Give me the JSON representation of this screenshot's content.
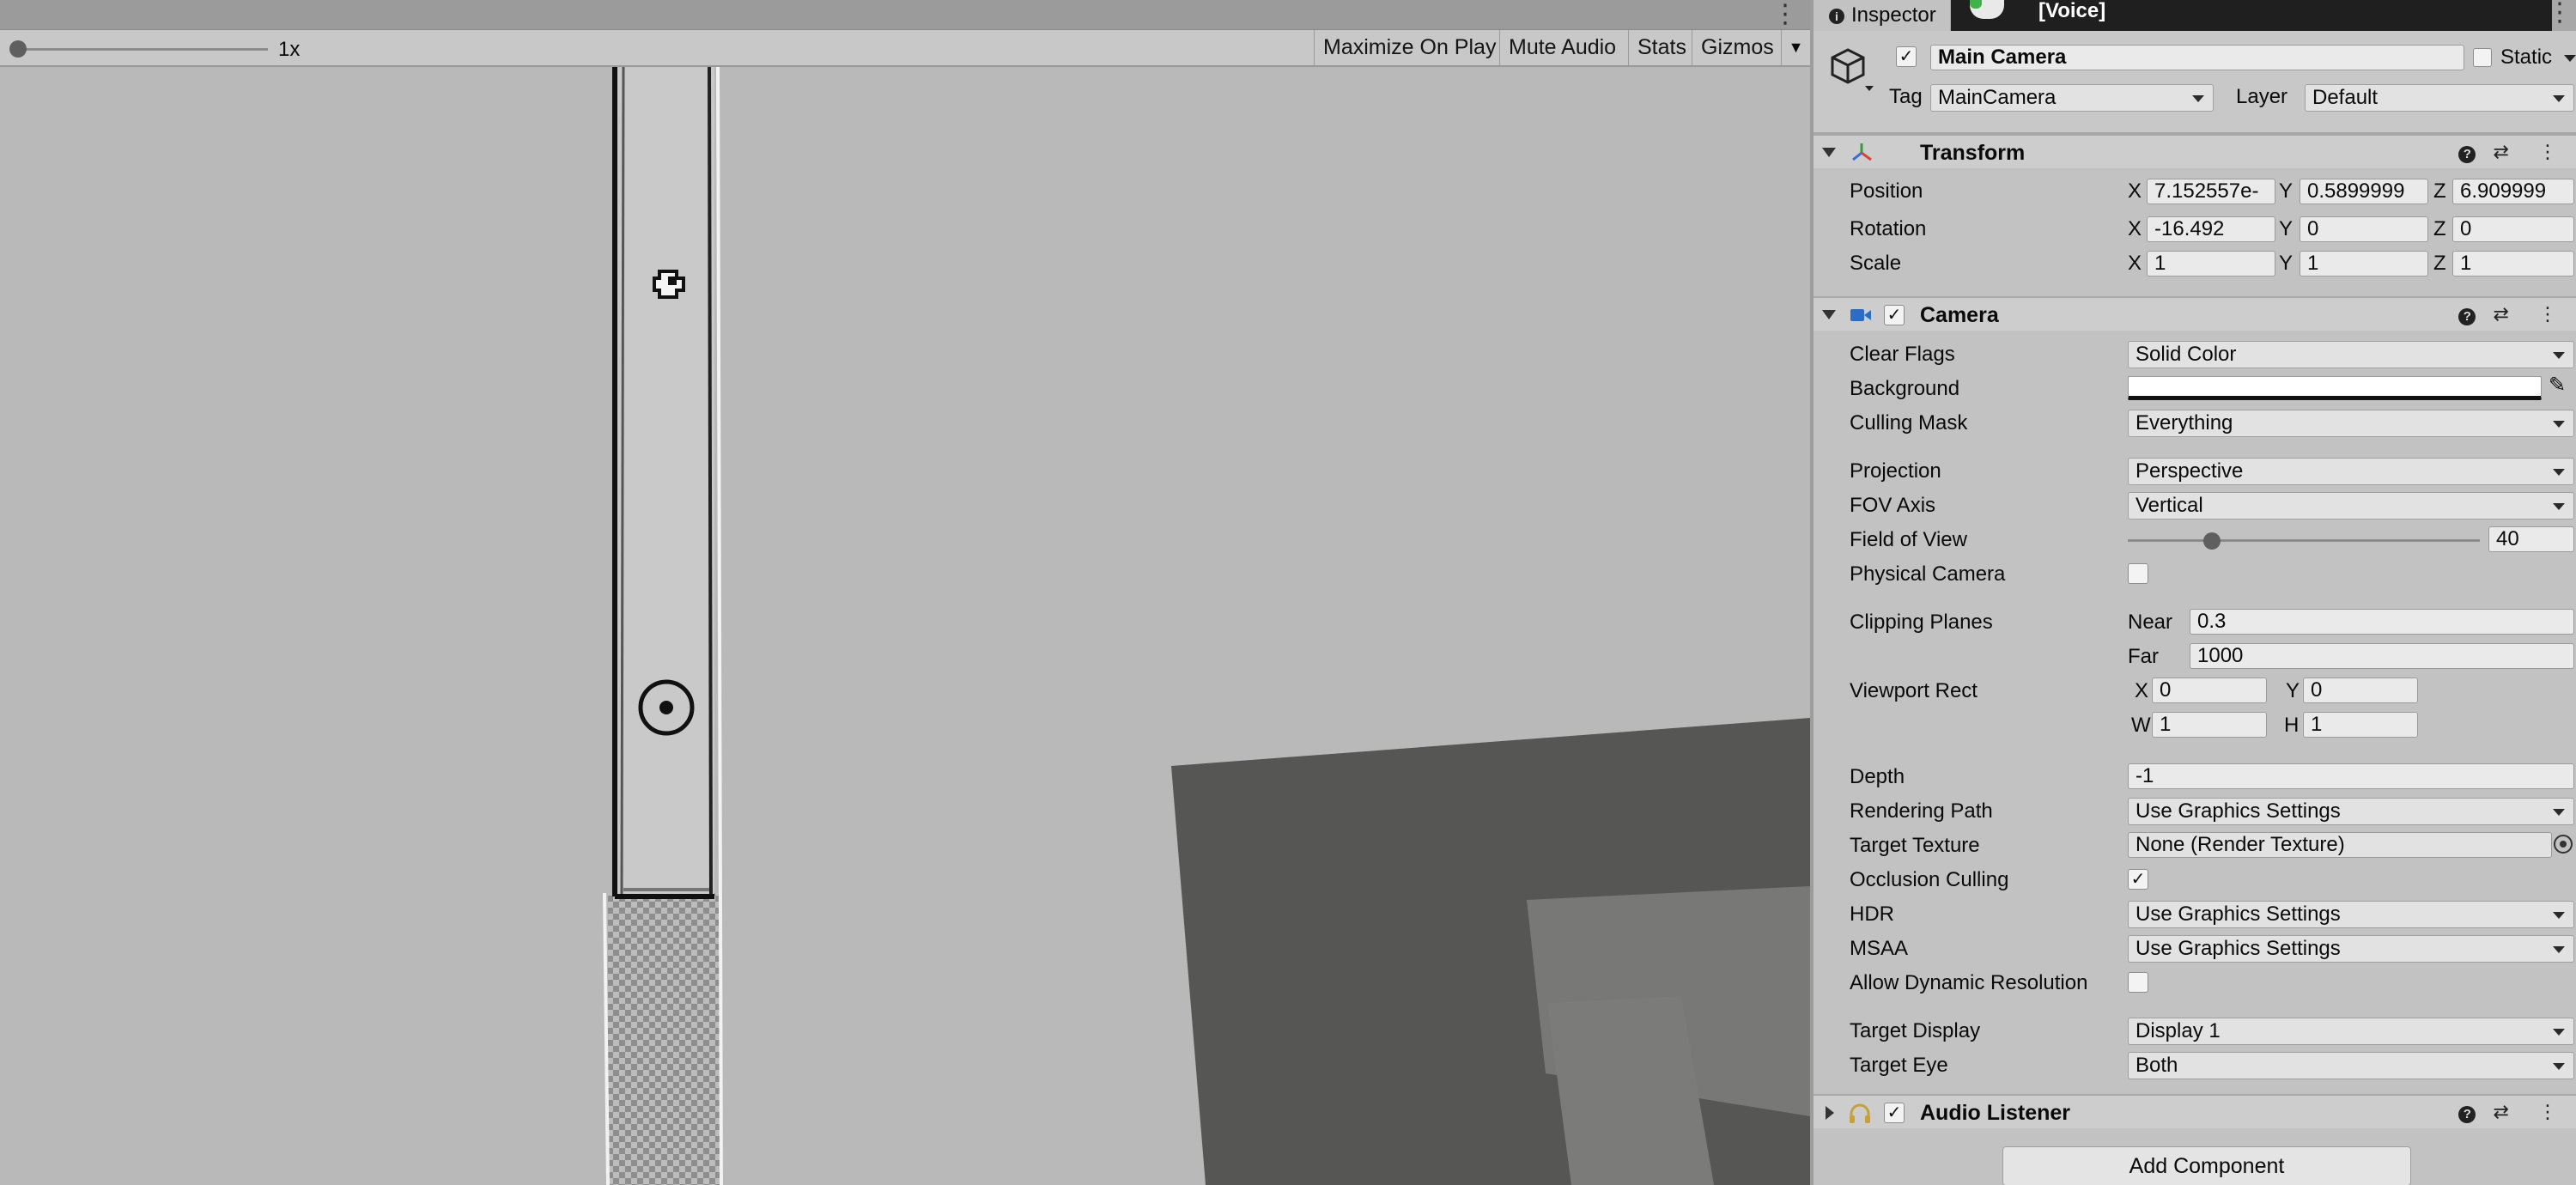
{
  "game_toolbar": {
    "scale_value": "1x",
    "buttons": [
      "Maximize On Play",
      "Mute Audio",
      "Stats",
      "Gizmos"
    ]
  },
  "inspector": {
    "tab": "Inspector",
    "voice_popup": "[Voice]",
    "gameobject": {
      "enabled": true,
      "name": "Main Camera",
      "static_label": "Static",
      "tag_label": "Tag",
      "tag": "MainCamera",
      "layer_label": "Layer",
      "layer": "Default"
    },
    "transform": {
      "title": "Transform",
      "position_label": "Position",
      "rotation_label": "Rotation",
      "scale_label": "Scale",
      "position": {
        "x": "7.152557e-",
        "y": "0.5899999",
        "z": "6.909999"
      },
      "rotation": {
        "x": "-16.492",
        "y": "0",
        "z": "0"
      },
      "scale": {
        "x": "1",
        "y": "1",
        "z": "1"
      }
    },
    "camera": {
      "title": "Camera",
      "clear_flags_label": "Clear Flags",
      "clear_flags": "Solid Color",
      "background_label": "Background",
      "background_color": "#ffffff",
      "culling_mask_label": "Culling Mask",
      "culling_mask": "Everything",
      "projection_label": "Projection",
      "projection": "Perspective",
      "fov_axis_label": "FOV Axis",
      "fov_axis": "Vertical",
      "fov_label": "Field of View",
      "fov": "40",
      "fov_slider_fraction": 0.24,
      "physical_camera_label": "Physical Camera",
      "clipping_label": "Clipping Planes",
      "near_label": "Near",
      "near": "0.3",
      "far_label": "Far",
      "far": "1000",
      "viewport_label": "Viewport Rect",
      "viewport": {
        "x": "0",
        "y": "0",
        "w": "1",
        "h": "1"
      },
      "depth_label": "Depth",
      "depth": "-1",
      "rendering_path_label": "Rendering Path",
      "rendering_path": "Use Graphics Settings",
      "target_texture_label": "Target Texture",
      "target_texture": "None (Render Texture)",
      "occlusion_label": "Occlusion Culling",
      "hdr_label": "HDR",
      "hdr": "Use Graphics Settings",
      "msaa_label": "MSAA",
      "msaa": "Use Graphics Settings",
      "dyn_res_label": "Allow Dynamic Resolution",
      "target_display_label": "Target Display",
      "target_display": "Display 1",
      "target_eye_label": "Target Eye",
      "target_eye": "Both"
    },
    "audio_listener": {
      "title": "Audio Listener"
    },
    "add_component": "Add Component",
    "axis": {
      "x": "X",
      "y": "Y",
      "z": "Z",
      "w": "W",
      "h": "H"
    }
  },
  "colors": {
    "sky": "#b9b9b9",
    "ground_dark": "#565655",
    "ground_mid": "#787877",
    "checker_a": "#bcbcbc",
    "checker_b": "#8e8e8e"
  }
}
